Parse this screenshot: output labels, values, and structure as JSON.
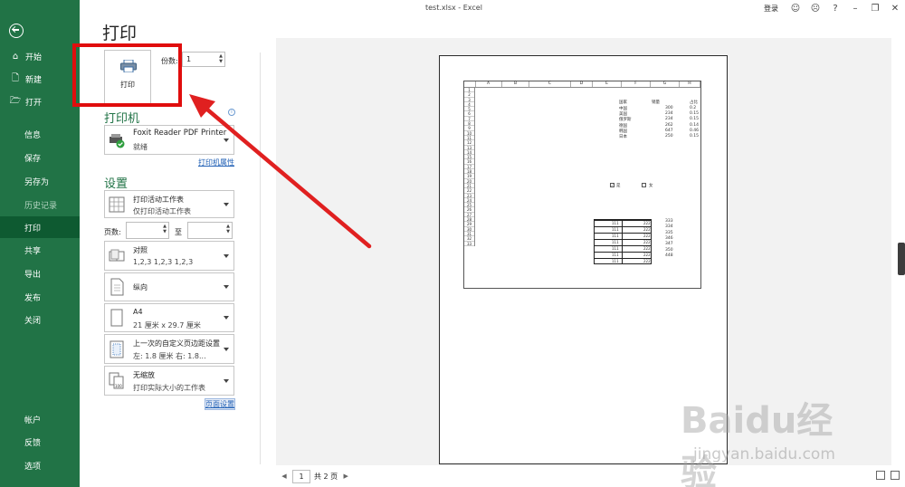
{
  "window": {
    "title": "test.xlsx  -  Excel",
    "login": "登录",
    "help": "?"
  },
  "nav": {
    "items": [
      {
        "label": "开始",
        "icon": "⌂"
      },
      {
        "label": "新建",
        "icon": "🗋"
      },
      {
        "label": "打开",
        "icon": "🗁"
      },
      {
        "label": "信息"
      },
      {
        "label": "保存"
      },
      {
        "label": "另存为"
      },
      {
        "label": "历史记录"
      },
      {
        "label": "打印"
      },
      {
        "label": "共享"
      },
      {
        "label": "导出"
      },
      {
        "label": "发布"
      },
      {
        "label": "关闭"
      },
      {
        "label": "帐户"
      },
      {
        "label": "反馈"
      },
      {
        "label": "选项"
      }
    ]
  },
  "print": {
    "heading": "打印",
    "button_label": "打印",
    "copies_label": "份数:",
    "copies_value": "1",
    "printer_section": "打印机",
    "printer_name": "Foxit Reader PDF Printer",
    "printer_status": "就绪",
    "printer_props": "打印机属性",
    "settings_section": "设置",
    "what_to_print": "打印活动工作表",
    "what_to_print_sub": "仅打印活动工作表",
    "pages_label": "页数:",
    "to_label": "至",
    "collate": "对照",
    "collate_sub": "1,2,3     1,2,3     1,2,3",
    "orientation": "纵向",
    "paper": "A4",
    "paper_sub": "21 厘米 x 29.7 厘米",
    "margins": "上一次的自定义页边距设置",
    "margins_sub": "左: 1.8 厘米     右: 1.8...",
    "scaling": "无缩放",
    "scaling_sub": "打印实际大小的工作表",
    "page_setup": "页面设置"
  },
  "preview": {
    "columns": [
      "A",
      "B",
      "C",
      "D",
      "E",
      "F",
      "G",
      "H"
    ],
    "rows": [
      "1",
      "2",
      "3",
      "4",
      "5",
      "6",
      "7",
      "8",
      "9",
      "10",
      "11",
      "12",
      "13",
      "14",
      "15",
      "16",
      "17",
      "18",
      "19",
      "20",
      "21",
      "22",
      "23",
      "24",
      "25",
      "26",
      "27",
      "28",
      "29",
      "30",
      "31",
      "32",
      "33"
    ],
    "header": [
      "国家",
      "销量",
      "占比"
    ],
    "table": [
      [
        "中国",
        "300",
        "0.2"
      ],
      [
        "美国",
        "234",
        "0.15"
      ],
      [
        "俄罗斯",
        "234",
        "0.15"
      ],
      [
        "德国",
        "262",
        "0.14"
      ],
      [
        "韩国",
        "647",
        "0.46"
      ],
      [
        "日本",
        "250",
        "0.15"
      ]
    ],
    "checkbox_yes": "是",
    "checkbox_no": "女",
    "numbers": [
      "333",
      "334",
      "335",
      "346",
      "347",
      "350",
      "448"
    ],
    "cell_left": "111",
    "cell_right": "222"
  },
  "pager": {
    "current": "1",
    "total": "共 2 页"
  },
  "watermark": {
    "logo": "Baidu经验",
    "url": "jingyan.baidu.com"
  },
  "colors": {
    "nav_bg": "#217346",
    "nav_active": "#0e5a31",
    "highlight": "#e00d0d",
    "section": "#217346"
  }
}
